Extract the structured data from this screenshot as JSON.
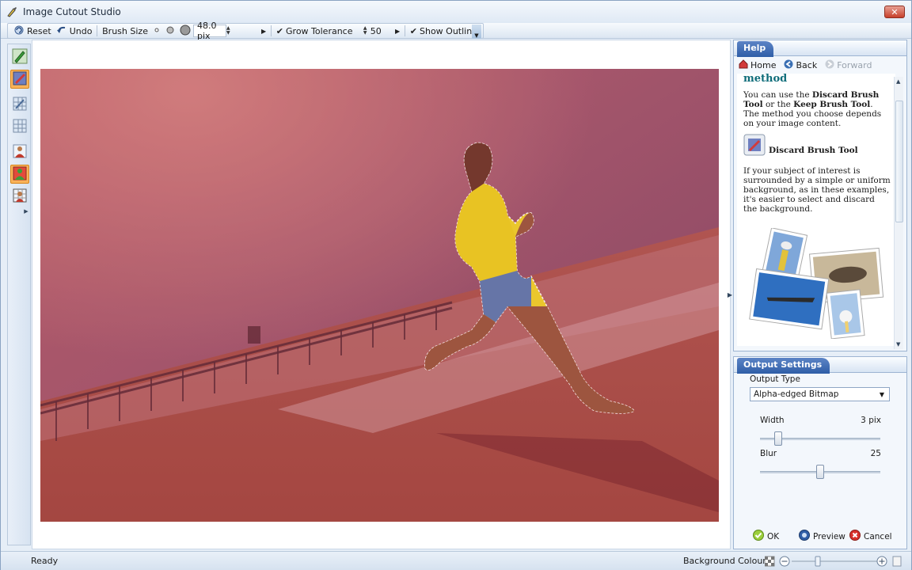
{
  "window": {
    "title": "Image Cutout Studio",
    "close_glyph": "✕"
  },
  "toolbar": {
    "reset": "Reset",
    "undo": "Undo",
    "brush_size_label": "Brush Size",
    "brush_size_value": "48.0 pix",
    "grow_tolerance_label": "Grow Tolerance",
    "grow_tolerance_value": "50",
    "show_outline_label": "Show Outline",
    "grow_tolerance_checked": true,
    "show_outline_checked": true
  },
  "left_tools": [
    "pencil-keep-icon",
    "discard-brush-icon",
    "grid-select-icon",
    "grid-fill-icon",
    "person-icon",
    "person-green-icon",
    "person-frame-icon"
  ],
  "help": {
    "title": "Help",
    "nav": {
      "home": "Home",
      "back": "Back",
      "forward": "Forward"
    },
    "heading": "method",
    "para1_a": "You can use the ",
    "para1_b": "Discard Brush Tool",
    "para1_c": " or the ",
    "para1_d": "Keep Brush Tool",
    "para1_e": ". The method you choose depends on your image content.",
    "tool_label": "Discard Brush Tool",
    "para2": "If your subject of interest is surrounded by a simple or uniform background, as in these examples, it's easier to select and discard the background."
  },
  "output": {
    "title": "Output Settings",
    "output_type_label": "Output Type",
    "output_type_value": "Alpha-edged Bitmap",
    "width_label": "Width",
    "width_value": "3 pix",
    "blur_label": "Blur",
    "blur_value": "25",
    "width_slider_fraction": 0.15,
    "blur_slider_fraction": 0.5,
    "ok": "OK",
    "preview": "Preview",
    "cancel": "Cancel"
  },
  "status": {
    "text": "Ready",
    "background_colour": "Background Colour"
  },
  "colors": {
    "accent": "#2f5ea7",
    "active_tool": "#f9b35a",
    "tint": "#c8605f"
  }
}
